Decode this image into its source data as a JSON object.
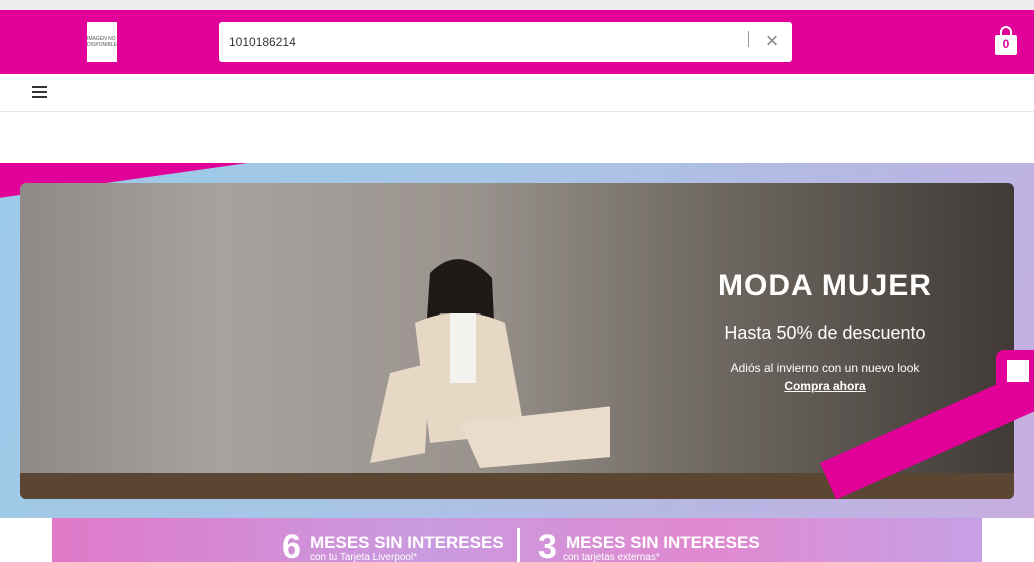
{
  "header": {
    "logo_text": "IMAGEN NO DISPONIBLE",
    "search_value": "1010186214",
    "bag_count": "0"
  },
  "hero": {
    "title": "MODA MUJER",
    "subtitle": "Hasta 50% de descuento",
    "note": "Adiós al invierno con un nuevo look",
    "link": "Compra ahora"
  },
  "promo": {
    "left_number": "6",
    "left_title": "MESES SIN INTERESES",
    "left_sub": "con tu Tarjeta Liverpool*",
    "right_number": "3",
    "right_title": "MESES SIN INTERESES",
    "right_sub": "con tarjetas externas*"
  },
  "colors": {
    "brand": "#e10098"
  },
  "icons": [
    "clear-icon",
    "shopping-bag-icon",
    "menu-icon"
  ]
}
